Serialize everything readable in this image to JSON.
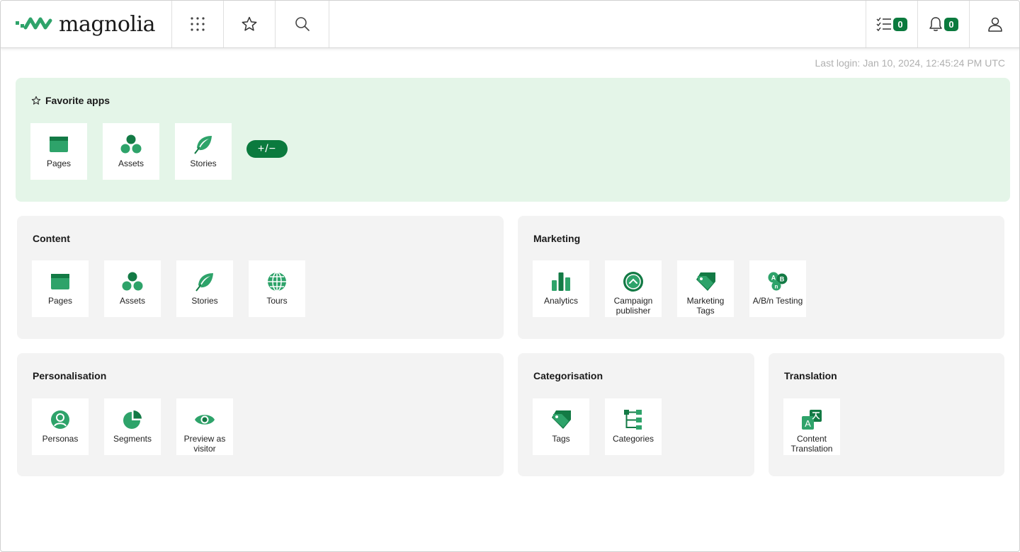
{
  "brand": {
    "name": "magnolia",
    "accent": "#2ea36a",
    "dark_accent": "#0b7a3e"
  },
  "header": {
    "apps_icon": "grid-icon",
    "favorites_icon": "star-icon",
    "search_icon": "search-icon",
    "tasks_count": "0",
    "notifications_count": "0",
    "user_icon": "user-icon"
  },
  "last_login": "Last login: Jan 10, 2024, 12:45:24 PM UTC",
  "favorites": {
    "title": "Favorite apps",
    "add_remove_label": "+/−",
    "apps": [
      {
        "label": "Pages",
        "icon": "pages-icon"
      },
      {
        "label": "Assets",
        "icon": "assets-icon"
      },
      {
        "label": "Stories",
        "icon": "stories-icon"
      }
    ]
  },
  "groups": {
    "content": {
      "title": "Content",
      "apps": [
        {
          "label": "Pages",
          "icon": "pages-icon"
        },
        {
          "label": "Assets",
          "icon": "assets-icon"
        },
        {
          "label": "Stories",
          "icon": "stories-icon"
        },
        {
          "label": "Tours",
          "icon": "globe-icon"
        }
      ]
    },
    "marketing": {
      "title": "Marketing",
      "apps": [
        {
          "label": "Analytics",
          "icon": "analytics-icon"
        },
        {
          "label": "Campaign publisher",
          "icon": "campaign-icon"
        },
        {
          "label": "Marketing Tags",
          "icon": "tag-icon"
        },
        {
          "label": "A/B/n Testing",
          "icon": "abn-icon"
        }
      ]
    },
    "personalisation": {
      "title": "Personalisation",
      "apps": [
        {
          "label": "Personas",
          "icon": "persona-icon"
        },
        {
          "label": "Segments",
          "icon": "pie-icon"
        },
        {
          "label": "Preview as visitor",
          "icon": "eye-icon"
        }
      ]
    },
    "categorisation": {
      "title": "Categorisation",
      "apps": [
        {
          "label": "Tags",
          "icon": "tag-icon"
        },
        {
          "label": "Categories",
          "icon": "tree-icon"
        }
      ]
    },
    "translation": {
      "title": "Translation",
      "apps": [
        {
          "label": "Content Translation",
          "icon": "translate-icon"
        }
      ]
    }
  }
}
